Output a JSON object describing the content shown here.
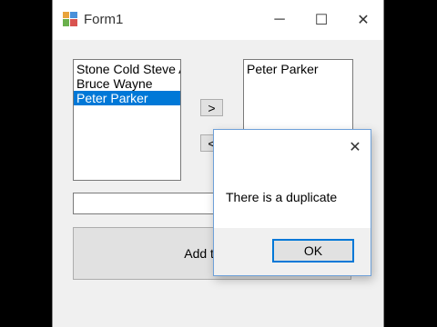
{
  "window": {
    "title": "Form1"
  },
  "left_list": {
    "items": [
      "Stone Cold Steve Austin",
      "Bruce Wayne",
      "Peter Parker"
    ],
    "selected_index": 2
  },
  "right_list": {
    "items": [
      "Peter Parker"
    ]
  },
  "buttons": {
    "move_right": ">",
    "move_left": "<",
    "add_to_list": "Add to list"
  },
  "textbox": {
    "value": ""
  },
  "dialog": {
    "close_glyph": "✕",
    "message": "There is a duplicate",
    "ok_label": "OK"
  },
  "caption": {
    "minimize": "─",
    "maximize": "☐",
    "close": "✕"
  },
  "colors": {
    "selection": "#0078d7",
    "dialog_border": "#6ea0d8"
  }
}
